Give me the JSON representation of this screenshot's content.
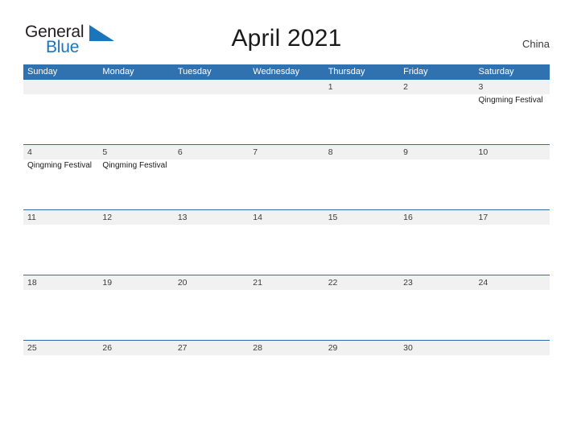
{
  "brand": {
    "name_part1": "General",
    "name_part2": "Blue",
    "flag_icon": "blue-triangle-flag-icon"
  },
  "header": {
    "title": "April 2021",
    "country": "China"
  },
  "colors": {
    "header_blue": "#3071b0",
    "row_border_blue": "#2e6da9",
    "band_gray": "#f1f1f1",
    "logo_blue": "#1b75bb",
    "text_dark": "#3b3b3b"
  },
  "calendar": {
    "weekdays": [
      "Sunday",
      "Monday",
      "Tuesday",
      "Wednesday",
      "Thursday",
      "Friday",
      "Saturday"
    ],
    "weeks": [
      [
        {
          "date": "",
          "event": ""
        },
        {
          "date": "",
          "event": ""
        },
        {
          "date": "",
          "event": ""
        },
        {
          "date": "",
          "event": ""
        },
        {
          "date": "1",
          "event": ""
        },
        {
          "date": "2",
          "event": ""
        },
        {
          "date": "3",
          "event": "Qingming Festival"
        }
      ],
      [
        {
          "date": "4",
          "event": "Qingming Festival"
        },
        {
          "date": "5",
          "event": "Qingming Festival"
        },
        {
          "date": "6",
          "event": ""
        },
        {
          "date": "7",
          "event": ""
        },
        {
          "date": "8",
          "event": ""
        },
        {
          "date": "9",
          "event": ""
        },
        {
          "date": "10",
          "event": ""
        }
      ],
      [
        {
          "date": "11",
          "event": ""
        },
        {
          "date": "12",
          "event": ""
        },
        {
          "date": "13",
          "event": ""
        },
        {
          "date": "14",
          "event": ""
        },
        {
          "date": "15",
          "event": ""
        },
        {
          "date": "16",
          "event": ""
        },
        {
          "date": "17",
          "event": ""
        }
      ],
      [
        {
          "date": "18",
          "event": ""
        },
        {
          "date": "19",
          "event": ""
        },
        {
          "date": "20",
          "event": ""
        },
        {
          "date": "21",
          "event": ""
        },
        {
          "date": "22",
          "event": ""
        },
        {
          "date": "23",
          "event": ""
        },
        {
          "date": "24",
          "event": ""
        }
      ],
      [
        {
          "date": "25",
          "event": ""
        },
        {
          "date": "26",
          "event": ""
        },
        {
          "date": "27",
          "event": ""
        },
        {
          "date": "28",
          "event": ""
        },
        {
          "date": "29",
          "event": ""
        },
        {
          "date": "30",
          "event": ""
        },
        {
          "date": "",
          "event": ""
        }
      ]
    ]
  }
}
